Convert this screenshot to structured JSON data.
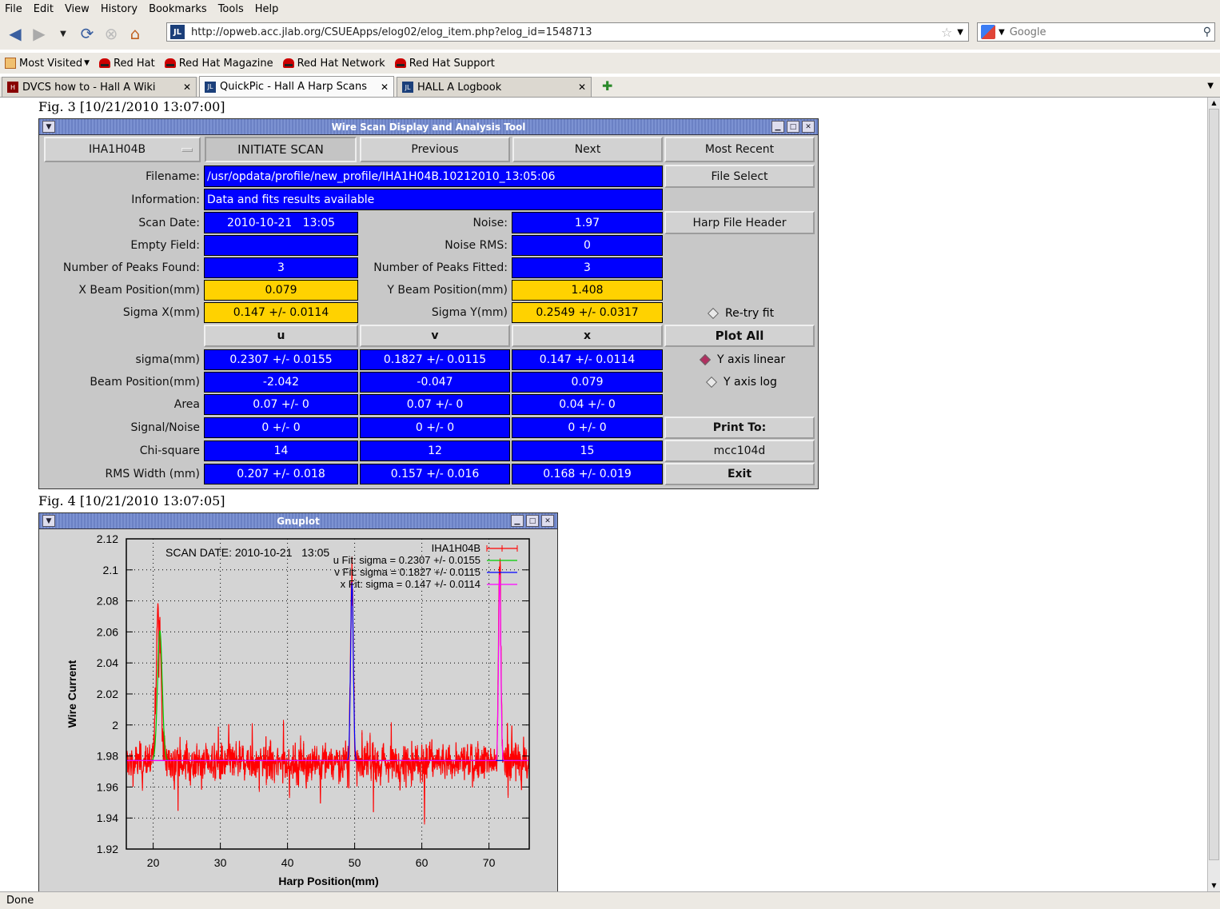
{
  "browser": {
    "menu": [
      "File",
      "Edit",
      "View",
      "History",
      "Bookmarks",
      "Tools",
      "Help"
    ],
    "url": "http://opweb.acc.jlab.org/CSUEApps/elog02/elog_item.php?elog_id=1548713",
    "search_placeholder": "Google",
    "bookmarks": [
      "Most Visited",
      "Red Hat",
      "Red Hat Magazine",
      "Red Hat Network",
      "Red Hat Support"
    ],
    "tabs": [
      {
        "label": "DVCS how to - Hall A Wiki",
        "active": false
      },
      {
        "label": "QuickPic - Hall A Harp Scans",
        "active": true
      },
      {
        "label": "HALL A Logbook",
        "active": false
      }
    ],
    "status": "Done"
  },
  "fig3": {
    "caption": "Fig. 3 [10/21/2010 13:07:00]",
    "window_title": "Wire Scan Display and Analysis Tool",
    "harp_select": "IHA1H04B",
    "buttons": {
      "initiate": "INITIATE SCAN",
      "previous": "Previous",
      "next": "Next",
      "most_recent": "Most Recent",
      "file_select": "File Select",
      "harp_header": "Harp File Header",
      "plot_all": "Plot All",
      "print_to": "Print To:",
      "printer": "mcc104d",
      "exit": "Exit"
    },
    "labels": {
      "filename": "Filename:",
      "information": "Information:",
      "scan_date": "Scan Date:",
      "noise": "Noise:",
      "empty_field": "Empty Field:",
      "noise_rms": "Noise RMS:",
      "peaks_found": "Number of Peaks Found:",
      "peaks_fitted": "Number of Peaks Fitted:",
      "x_beam": "X Beam Position(mm)",
      "y_beam": "Y Beam Position(mm)",
      "sigma_x": "Sigma X(mm)",
      "sigma_y": "Sigma Y(mm)"
    },
    "values": {
      "filename": "/usr/opdata/profile/new_profile/IHA1H04B.10212010_13:05:06",
      "information": "Data and fits results available",
      "scan_date": "2010-10-21   13:05",
      "noise": "1.97",
      "empty_field": "",
      "noise_rms": "0",
      "peaks_found": "3",
      "peaks_fitted": "3",
      "x_beam": "0.079",
      "y_beam": "1.408",
      "sigma_x": "0.147 +/- 0.0114",
      "sigma_y": "0.2549 +/- 0.0317"
    },
    "radios": {
      "retry": "Re-try fit",
      "ylinear": "Y axis linear",
      "ylog": "Y axis log"
    },
    "table": {
      "headers": [
        "u",
        "v",
        "x"
      ],
      "rows": [
        {
          "label": "sigma(mm)",
          "cells": [
            "0.2307 +/- 0.0155",
            "0.1827 +/- 0.0115",
            "0.147 +/- 0.0114"
          ]
        },
        {
          "label": "Beam Position(mm)",
          "cells": [
            "-2.042",
            "-0.047",
            "0.079"
          ]
        },
        {
          "label": "Area",
          "cells": [
            "0.07 +/- 0",
            "0.07 +/- 0",
            "0.04 +/- 0"
          ]
        },
        {
          "label": "Signal/Noise",
          "cells": [
            "0 +/- 0",
            "0 +/- 0",
            "0 +/- 0"
          ]
        },
        {
          "label": "Chi-square",
          "cells": [
            "14",
            "12",
            "15"
          ]
        },
        {
          "label": "RMS Width (mm)",
          "cells": [
            "0.207 +/- 0.018",
            "0.157 +/- 0.016",
            "0.168 +/- 0.019"
          ]
        }
      ]
    }
  },
  "fig4": {
    "caption": "Fig. 4 [10/21/2010 13:07:05]",
    "window_title": "Gnuplot"
  },
  "chart_data": {
    "type": "line",
    "title": "",
    "annotation": "SCAN DATE: 2010-10-21   13:05",
    "xlabel": "Harp Position(mm)",
    "ylabel": "Wire Current",
    "xlim": [
      16,
      76
    ],
    "ylim": [
      1.92,
      2.12
    ],
    "xticks": [
      20,
      30,
      40,
      50,
      60,
      70
    ],
    "yticks": [
      1.92,
      1.94,
      1.96,
      1.98,
      2,
      2.02,
      2.04,
      2.06,
      2.08,
      2.1,
      2.12
    ],
    "grid": true,
    "legend_position": "top-right",
    "series": [
      {
        "name": "IHA1H04B",
        "color": "#ff0000",
        "kind": "data",
        "baseline": 1.976,
        "noise": 0.006,
        "peaks": [
          {
            "center": 20.8,
            "amplitude": 0.1,
            "sigma": 0.35
          },
          {
            "center": 49.6,
            "amplitude": 0.12,
            "sigma": 0.2
          },
          {
            "center": 71.6,
            "amplitude": 0.125,
            "sigma": 0.18
          }
        ]
      },
      {
        "name": "u  Fit: sigma = 0.2307 +/- 0.0155",
        "color": "#00cc00",
        "kind": "fit",
        "center": 21.0,
        "amplitude": 0.084,
        "sigma": 0.35,
        "baseline": 1.977
      },
      {
        "name": "v  Fit: sigma = 0.1827 +/- 0.0115",
        "color": "#0000ff",
        "kind": "fit",
        "center": 49.6,
        "amplitude": 0.115,
        "sigma": 0.2,
        "baseline": 1.977
      },
      {
        "name": "x  Fit: sigma = 0.147 +/- 0.0114",
        "color": "#ff00ff",
        "kind": "fit",
        "center": 71.6,
        "amplitude": 0.12,
        "sigma": 0.17,
        "baseline": 1.977
      }
    ]
  }
}
